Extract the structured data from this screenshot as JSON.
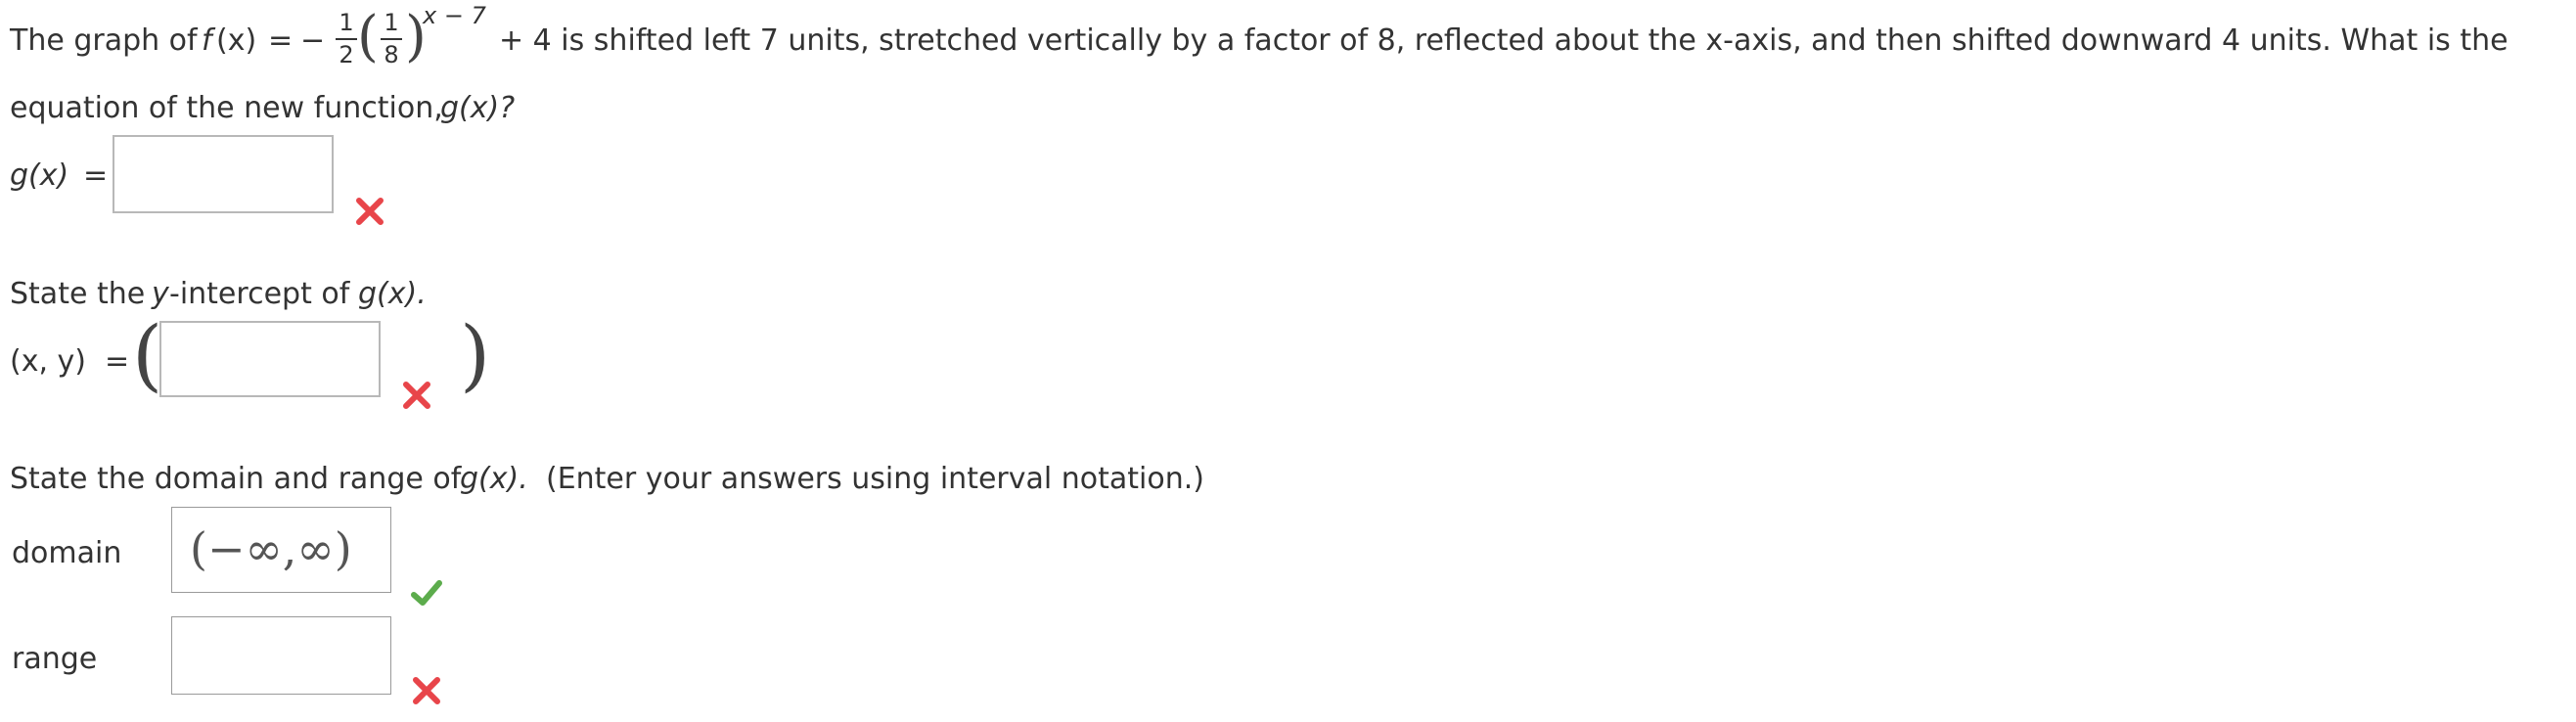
{
  "question": {
    "intro": "The graph of",
    "f_name": "f",
    "f_arg": "(x)",
    "equals": "=",
    "minus": "−",
    "frac_outer_num": "1",
    "frac_outer_den": "2",
    "frac_inner_num": "1",
    "frac_inner_den": "8",
    "exponent": "x − 7",
    "tail": "+ 4 is shifted left 7 units, stretched vertically by a factor of 8, reflected about the x-axis, and then shifted downward 4 units. What is the",
    "line2_text": "equation of the new function,",
    "line2_func": "g(x)?"
  },
  "part1": {
    "label_func": "g(x)",
    "label_eq": "=",
    "answer_value": "",
    "status": "incorrect"
  },
  "part2": {
    "prompt_pre": "State the",
    "prompt_var": "y",
    "prompt_post": "-intercept of",
    "prompt_func": "g(x).",
    "label": "(x, y)",
    "label_eq": "=",
    "answer_value": "",
    "status": "incorrect"
  },
  "part3": {
    "prompt_pre": "State the domain and range of",
    "prompt_func": "g(x).",
    "prompt_post": "(Enter your answers using interval notation.)",
    "domain_label": "domain",
    "domain_value": "(−∞,∞)",
    "domain_status": "correct",
    "range_label": "range",
    "range_value": "",
    "range_status": "incorrect"
  },
  "colors": {
    "text": "#333333",
    "incorrect": "#e8454a",
    "correct": "#5cac4c",
    "box_border": "#b8b8b8"
  }
}
